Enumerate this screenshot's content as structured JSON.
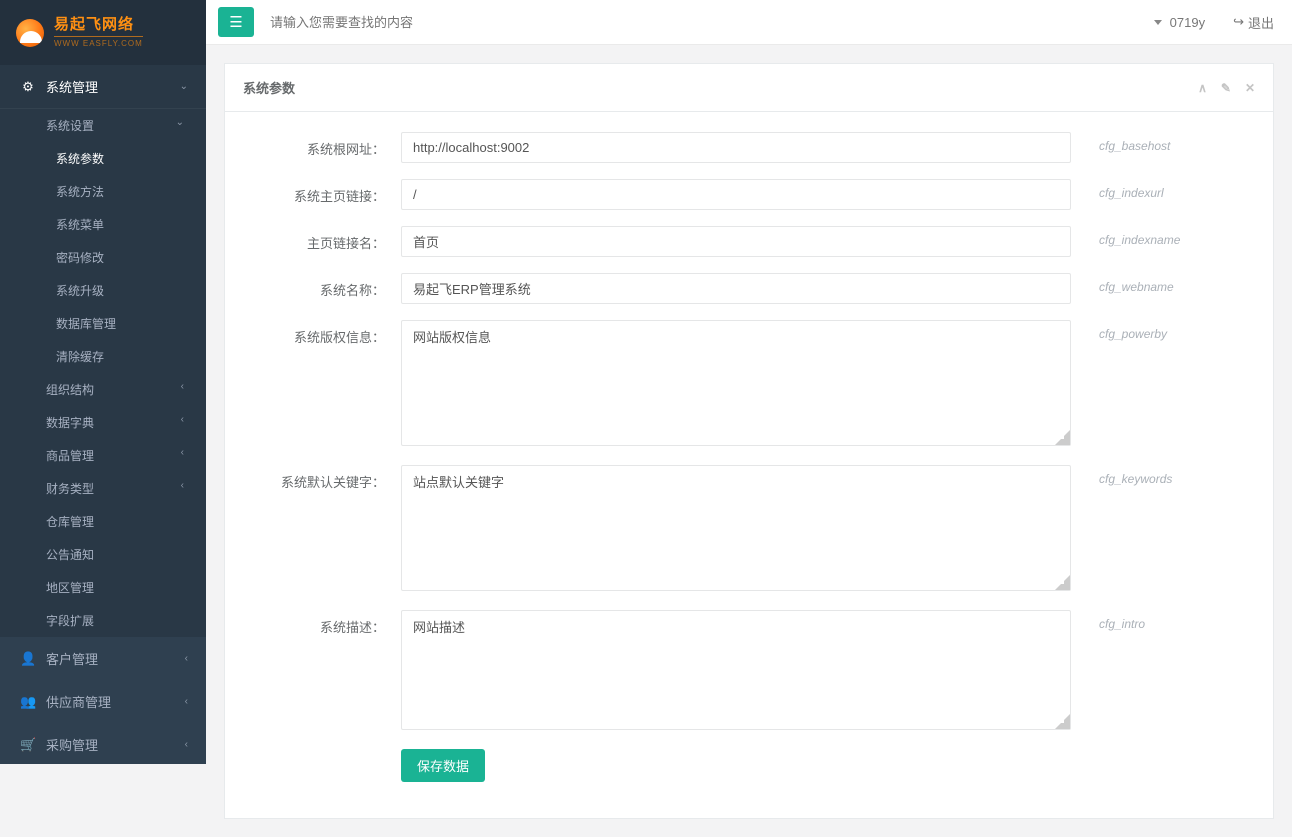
{
  "brand": {
    "name": "易起飞网络",
    "sub": "WWW EASFLY.COM"
  },
  "topbar": {
    "search_placeholder": "请输入您需要查找的内容",
    "greeting": "0719y",
    "logout": "退出"
  },
  "sidebar": {
    "section1": {
      "title": "系统管理",
      "group_settings": {
        "title": "系统设置",
        "items": [
          "系统参数",
          "系统方法",
          "系统菜单",
          "密码修改",
          "系统升级",
          "数据库管理",
          "清除缓存"
        ]
      },
      "items": [
        "组织结构",
        "数据字典",
        "商品管理",
        "财务类型",
        "仓库管理",
        "公告通知",
        "地区管理",
        "字段扩展"
      ]
    },
    "section2": {
      "title": "客户管理"
    },
    "section3": {
      "title": "供应商管理"
    },
    "section4": {
      "title": "采购管理"
    }
  },
  "panel": {
    "title": "系统参数",
    "fields": [
      {
        "label": "系统根网址：",
        "value": "http://localhost:9002",
        "hint": "cfg_basehost",
        "type": "input"
      },
      {
        "label": "系统主页链接：",
        "value": "/",
        "hint": "cfg_indexurl",
        "type": "input"
      },
      {
        "label": "主页链接名：",
        "value": "首页",
        "hint": "cfg_indexname",
        "type": "input"
      },
      {
        "label": "系统名称：",
        "value": "易起飞ERP管理系统",
        "hint": "cfg_webname",
        "type": "input"
      },
      {
        "label": "系统版权信息：",
        "value": "网站版权信息",
        "hint": "cfg_powerby",
        "type": "textarea"
      },
      {
        "label": "系统默认关键字：",
        "value": "站点默认关键字",
        "hint": "cfg_keywords",
        "type": "textarea"
      },
      {
        "label": "系统描述：",
        "value": "网站描述",
        "hint": "cfg_intro",
        "type": "textarea"
      }
    ],
    "save_label": "保存数据"
  }
}
